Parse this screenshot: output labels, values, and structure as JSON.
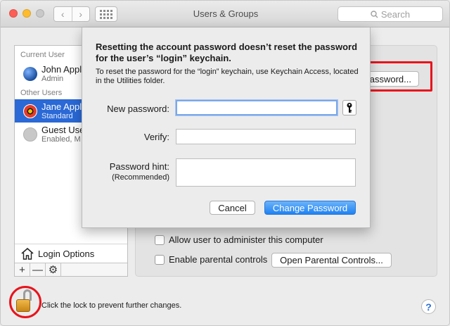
{
  "window": {
    "title": "Users & Groups",
    "search_placeholder": "Search",
    "nav_back": "‹",
    "nav_forward": "›"
  },
  "sidebar": {
    "current_user_header": "Current User",
    "other_users_header": "Other Users",
    "users": [
      {
        "name": "John Appl",
        "role": "Admin"
      },
      {
        "name": "Jane Appl",
        "role": "Standard"
      },
      {
        "name": "Guest Use",
        "role": "Enabled, M"
      }
    ],
    "login_options_label": "Login Options",
    "add_label": "+",
    "remove_label": "—"
  },
  "panel": {
    "reset_password_label": "assword...",
    "allow_admin_label": "Allow user to administer this computer",
    "parental_controls_label": "Enable parental controls",
    "open_parental_label": "Open Parental Controls..."
  },
  "footer": {
    "lock_text": "Click the lock to prevent further changes.",
    "help_label": "?"
  },
  "sheet": {
    "title": "Resetting the account password doesn’t reset the password for the user’s “login” keychain.",
    "message": "To reset the password for the “login” keychain, use Keychain Access, located in the Utilities folder.",
    "new_password_label": "New password:",
    "verify_label": "Verify:",
    "hint_label": "Password hint:",
    "hint_sub": "(Recommended)",
    "new_password_value": "",
    "verify_value": "",
    "hint_value": "",
    "cancel_label": "Cancel",
    "change_label": "Change Password"
  },
  "colors": {
    "selection": "#2a69d6",
    "primary_button": "#1f82f2",
    "annotation": "#e8141c"
  }
}
